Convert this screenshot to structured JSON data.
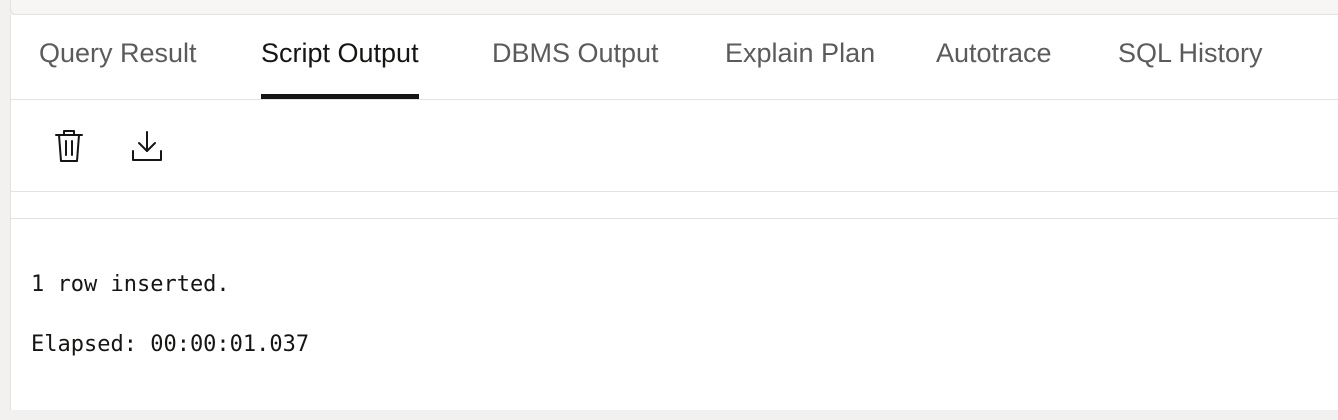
{
  "tabs": [
    {
      "label": "Query Result",
      "active": false
    },
    {
      "label": "Script Output",
      "active": true
    },
    {
      "label": "DBMS Output",
      "active": false
    },
    {
      "label": "Explain Plan",
      "active": false
    },
    {
      "label": "Autotrace",
      "active": false
    },
    {
      "label": "SQL History",
      "active": false
    }
  ],
  "toolbar": {
    "icons": [
      "trash-icon",
      "download-icon"
    ]
  },
  "output": {
    "line1": "1 row inserted.",
    "line2": "Elapsed: 00:00:01.037"
  }
}
